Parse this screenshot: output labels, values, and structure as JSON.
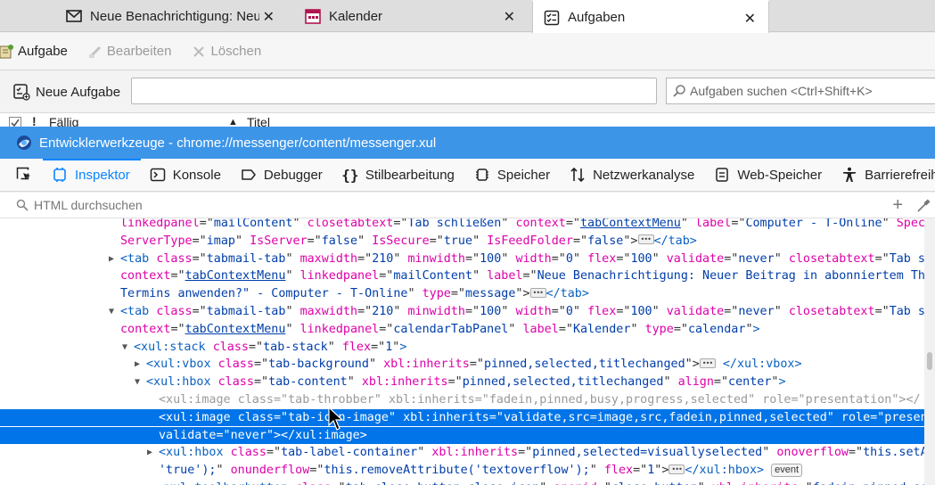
{
  "tabs": [
    {
      "title": "Neue Benachrichtigung: Neu",
      "icon": "mail-icon"
    },
    {
      "title": "Kalender",
      "icon": "calendar-icon"
    },
    {
      "title": "Aufgaben",
      "icon": "tasks-icon",
      "selected": true
    }
  ],
  "toolbar": {
    "new_task": "Aufgabe",
    "edit": "Bearbeiten",
    "delete": "Löschen"
  },
  "quick_add": {
    "label": "Neue Aufgabe",
    "value": ""
  },
  "task_search": {
    "placeholder": "Aufgaben suchen <Ctrl+Shift+K>"
  },
  "columns": {
    "due": "Fällig",
    "title": "Titel"
  },
  "devtools": {
    "title": "Entwicklerwerkzeuge - chrome://messenger/content/messenger.xul",
    "tabs": [
      "Inspektor",
      "Konsole",
      "Debugger",
      "Stilbearbeitung",
      "Speicher",
      "Netzwerkanalyse",
      "Web-Speicher",
      "Barrierefreiheit"
    ],
    "selected_tab": "Inspektor",
    "search_placeholder": "HTML durchsuchen"
  },
  "markup_lines": [
    {
      "indent": 135,
      "html": "<span class=\"an\">linkedpanel</span><span class=\"pu\">=\"</span><span class=\"av\">mailContent</span><span class=\"pu\">\" </span><span class=\"an\">closetabtext</span><span class=\"pu\">=\"</span><span class=\"av\">Tab schließen</span><span class=\"pu\">\" </span><span class=\"an\">context</span><span class=\"pu\">=\"</span><span class=\"av u\">tabContextMenu</span><span class=\"pu\">\" </span><span class=\"an\">label</span><span class=\"pu\">=\"</span><span class=\"av\">Computer - T-Online</span><span class=\"pu\">\" </span><span class=\"an\">Speci</span>"
    },
    {
      "indent": 135,
      "html": "<span class=\"an\">ServerType</span><span class=\"pu\">=\"</span><span class=\"av\">imap</span><span class=\"pu\">\" </span><span class=\"an\">IsServer</span><span class=\"pu\">=\"</span><span class=\"av\">false</span><span class=\"pu\">\" </span><span class=\"an\">IsSecure</span><span class=\"pu\">=\"</span><span class=\"av\">true</span><span class=\"pu\">\" </span><span class=\"an\">IsFeedFolder</span><span class=\"pu\">=\"</span><span class=\"av\">false</span><span class=\"pu\">\">[more]</span><span class=\"tg\">&lt;/tab&gt;</span>"
    },
    {
      "indent": 135,
      "twisty": "▶",
      "html": "<span class=\"tg\">&lt;tab</span> <span class=\"an\">class</span><span class=\"pu\">=\"</span><span class=\"av\">tabmail-tab</span><span class=\"pu\">\" </span><span class=\"an\">maxwidth</span><span class=\"pu\">=\"</span><span class=\"av\">210</span><span class=\"pu\">\" </span><span class=\"an\">minwidth</span><span class=\"pu\">=\"</span><span class=\"av\">100</span><span class=\"pu\">\" </span><span class=\"an\">width</span><span class=\"pu\">=\"</span><span class=\"av\">0</span><span class=\"pu\">\" </span><span class=\"an\">flex</span><span class=\"pu\">=\"</span><span class=\"av\">100</span><span class=\"pu\">\" </span><span class=\"an\">validate</span><span class=\"pu\">=\"</span><span class=\"av\">never</span><span class=\"pu\">\" </span><span class=\"an\">closetabtext</span><span class=\"pu\">=\"</span><span class=\"av\">Tab sc</span>"
    },
    {
      "indent": 135,
      "html": "<span class=\"an\">context</span><span class=\"pu\">=\"</span><span class=\"av u\">tabContextMenu</span><span class=\"pu\">\" </span><span class=\"an\">linkedpanel</span><span class=\"pu\">=\"</span><span class=\"av\">mailContent</span><span class=\"pu\">\" </span><span class=\"an\">label</span><span class=\"pu\">=\"</span><span class=\"av\">Neue Benachrichtigung: Neuer Beitrag in abonniertem The</span>"
    },
    {
      "indent": 135,
      "html": "<span class=\"av\">Termins anwenden?\" - Computer - T-Online</span><span class=\"pu\">\" </span><span class=\"an\">type</span><span class=\"pu\">=\"</span><span class=\"av\">message</span><span class=\"pu\">\">[more]</span><span class=\"tg\">&lt;/tab&gt;</span>"
    },
    {
      "indent": 135,
      "twisty": "▼",
      "html": "<span class=\"tg\">&lt;tab</span> <span class=\"an\">class</span><span class=\"pu\">=\"</span><span class=\"av\">tabmail-tab</span><span class=\"pu\">\" </span><span class=\"an\">maxwidth</span><span class=\"pu\">=\"</span><span class=\"av\">210</span><span class=\"pu\">\" </span><span class=\"an\">minwidth</span><span class=\"pu\">=\"</span><span class=\"av\">100</span><span class=\"pu\">\" </span><span class=\"an\">width</span><span class=\"pu\">=\"</span><span class=\"av\">0</span><span class=\"pu\">\" </span><span class=\"an\">flex</span><span class=\"pu\">=\"</span><span class=\"av\">100</span><span class=\"pu\">\" </span><span class=\"an\">validate</span><span class=\"pu\">=\"</span><span class=\"av\">never</span><span class=\"pu\">\" </span><span class=\"an\">closetabtext</span><span class=\"pu\">=\"</span><span class=\"av\">Tab sc</span>"
    },
    {
      "indent": 135,
      "html": "<span class=\"an\">context</span><span class=\"pu\">=\"</span><span class=\"av u\">tabContextMenu</span><span class=\"pu\">\" </span><span class=\"an\">linkedpanel</span><span class=\"pu\">=\"</span><span class=\"av\">calendarTabPanel</span><span class=\"pu\">\" </span><span class=\"an\">label</span><span class=\"pu\">=\"</span><span class=\"av\">Kalender</span><span class=\"pu\">\" </span><span class=\"an\">type</span><span class=\"pu\">=\"</span><span class=\"av\">calendar</span><span class=\"pu\">\"</span><span class=\"tg\">&gt;</span>"
    },
    {
      "indent": 150,
      "twisty": "▼",
      "html": "<span class=\"tg\">&lt;xul:stack</span> <span class=\"an\">class</span><span class=\"pu\">=\"</span><span class=\"av\">tab-stack</span><span class=\"pu\">\" </span><span class=\"an\">flex</span><span class=\"pu\">=\"</span><span class=\"av\">1</span><span class=\"pu\">\"</span><span class=\"tg\">&gt;</span>"
    },
    {
      "indent": 164,
      "twisty": "▶",
      "html": "<span class=\"tg\">&lt;xul:vbox</span> <span class=\"an\">class</span><span class=\"pu\">=\"</span><span class=\"av\">tab-background</span><span class=\"pu\">\" </span><span class=\"an\">xbl:inherits</span><span class=\"pu\">=\"</span><span class=\"av\">pinned,selected,titlechanged</span><span class=\"pu\">\"&gt;[more]</span> <span class=\"tg\">&lt;/xul:vbox&gt;</span>"
    },
    {
      "indent": 164,
      "twisty": "▼",
      "html": "<span class=\"tg\">&lt;xul:hbox</span> <span class=\"an\">class</span><span class=\"pu\">=\"</span><span class=\"av\">tab-content</span><span class=\"pu\">\" </span><span class=\"an\">xbl:inherits</span><span class=\"pu\">=\"</span><span class=\"av\">pinned,selected,titlechanged</span><span class=\"pu\">\" </span><span class=\"an\">align</span><span class=\"pu\">=\"</span><span class=\"av\">center</span><span class=\"pu\">\"</span><span class=\"tg\">&gt;</span>"
    },
    {
      "indent": 178,
      "dim": true,
      "html": "<span class=\"tg\">&lt;xul:image</span> <span class=\"an\">class</span><span class=\"pu\">=\"</span><span class=\"av\">tab-throbber</span><span class=\"pu\">\" </span><span class=\"an\">xbl:inherits</span><span class=\"pu\">=\"</span><span class=\"av\">fadein,pinned,busy,progress,selected</span><span class=\"pu\">\" </span><span class=\"an\">role</span><span class=\"pu\">=\"</span><span class=\"av\">presentation</span><span class=\"pu\">\"</span><span class=\"tg\">&gt;&lt;/</span>"
    },
    {
      "indent": 178,
      "hl": true,
      "html": "<span class=\"tg\">&lt;xul:image</span> <span class=\"an\">class</span><span class=\"pu\">=\"</span><span class=\"av\">tab-icon-image</span><span class=\"pu\">\" </span><span class=\"an\">xbl:inherits</span><span class=\"pu\">=\"</span><span class=\"av\">validate,src=image,src,fadein,pinned,selected</span><span class=\"pu\">\" </span><span class=\"an\">role</span><span class=\"pu\">=\"</span><span class=\"av\">present</span>"
    },
    {
      "indent": 178,
      "hl": true,
      "html": "<span class=\"an\">validate</span><span class=\"pu\">=\"</span><span class=\"av\">never</span><span class=\"pu\">\"</span><span class=\"tg\">&gt;&lt;/xul:image&gt;</span>"
    },
    {
      "indent": 178,
      "twisty": "▶",
      "html": "<span class=\"tg\">&lt;xul:hbox</span> <span class=\"an\">class</span><span class=\"pu\">=\"</span><span class=\"av\">tab-label-container</span><span class=\"pu\">\" </span><span class=\"an\">xbl:inherits</span><span class=\"pu\">=\"</span><span class=\"av\">pinned,selected=visuallyselected</span><span class=\"pu\">\" </span><span class=\"an\">onoverflow</span><span class=\"pu\">=\"</span><span class=\"av\">this.setAt</span>"
    },
    {
      "indent": 178,
      "html": "<span class=\"av\">'true');</span><span class=\"pu\">\" </span><span class=\"an\">onunderflow</span><span class=\"pu\">=\"</span><span class=\"av\">this.removeAttribute('textoverflow');</span><span class=\"pu\">\" </span><span class=\"an\">flex</span><span class=\"pu\">=\"</span><span class=\"av\">1</span><span class=\"pu\">\"&gt;[more]</span><span class=\"tg\">&lt;/xul:hbox&gt;</span> [event]"
    },
    {
      "indent": 178,
      "twisty": "▶",
      "html": "<span class=\"tg\">&lt;xul:toolbarbutton</span> <span class=\"an\">class</span><span class=\"pu\">=\"</span><span class=\"av\">tab-close-button close-icon</span><span class=\"pu\">\" </span><span class=\"an\">anonid</span><span class=\"pu\">=\"</span><span class=\"av\">close-button</span><span class=\"pu\">\" </span><span class=\"an\">xbl:inherits</span><span class=\"pu\">=\"</span><span class=\"av\">fadein,pinned,sel</span>"
    }
  ],
  "event_badge": "event"
}
